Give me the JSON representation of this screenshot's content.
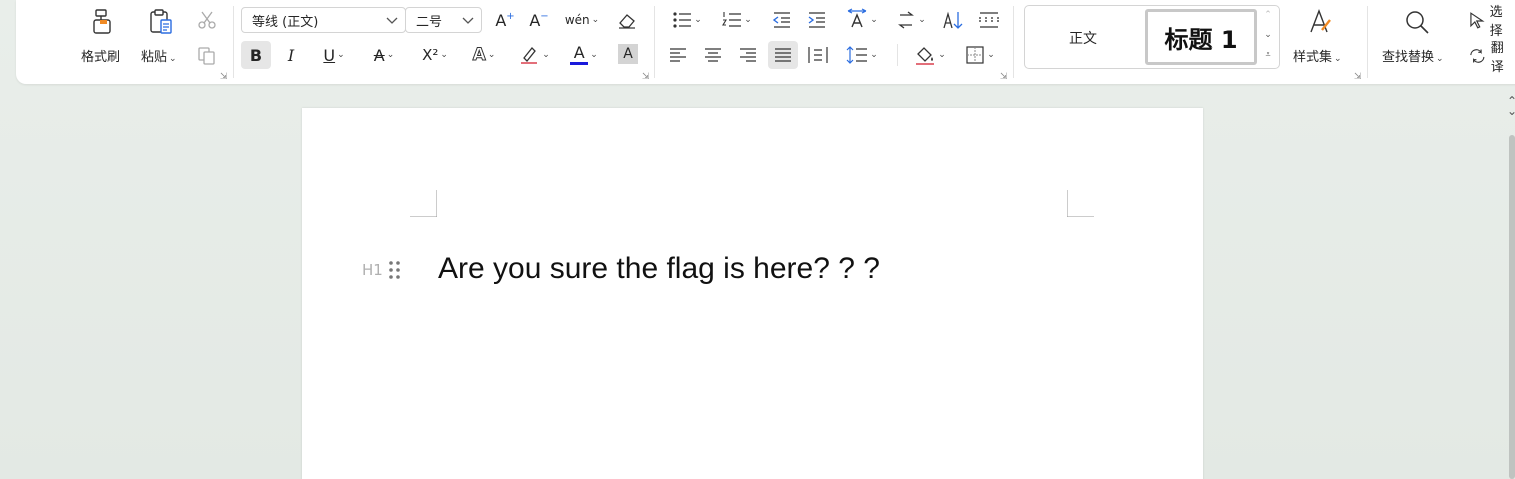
{
  "ribbon": {
    "clipboard": {
      "format_painter_label": "格式刷",
      "paste_label": "粘贴"
    },
    "font": {
      "font_name": "等线 (正文)",
      "font_size": "二号",
      "grow_font_glyph": "A",
      "shrink_font_glyph": "A",
      "pinyin_glyph": "wén",
      "bold_glyph": "B",
      "italic_glyph": "I",
      "underline_glyph": "U",
      "strikethrough_glyph": "A",
      "superscript_glyph": "X²",
      "text_effect_glyph": "A",
      "font_color_glyph": "A",
      "char_shading_glyph": "A",
      "font_color": "#1a1adb"
    },
    "styles": {
      "body_style": "正文",
      "heading1_style": "标题 1",
      "style_set_label": "样式集"
    },
    "editing": {
      "find_replace_label": "查找替换",
      "select_label": "选择",
      "translate_label": "翻译"
    },
    "accent_color": "#2b6de0"
  },
  "document": {
    "heading_marker": "H1",
    "heading_text": "Are you sure the flag is here? ? ?"
  }
}
